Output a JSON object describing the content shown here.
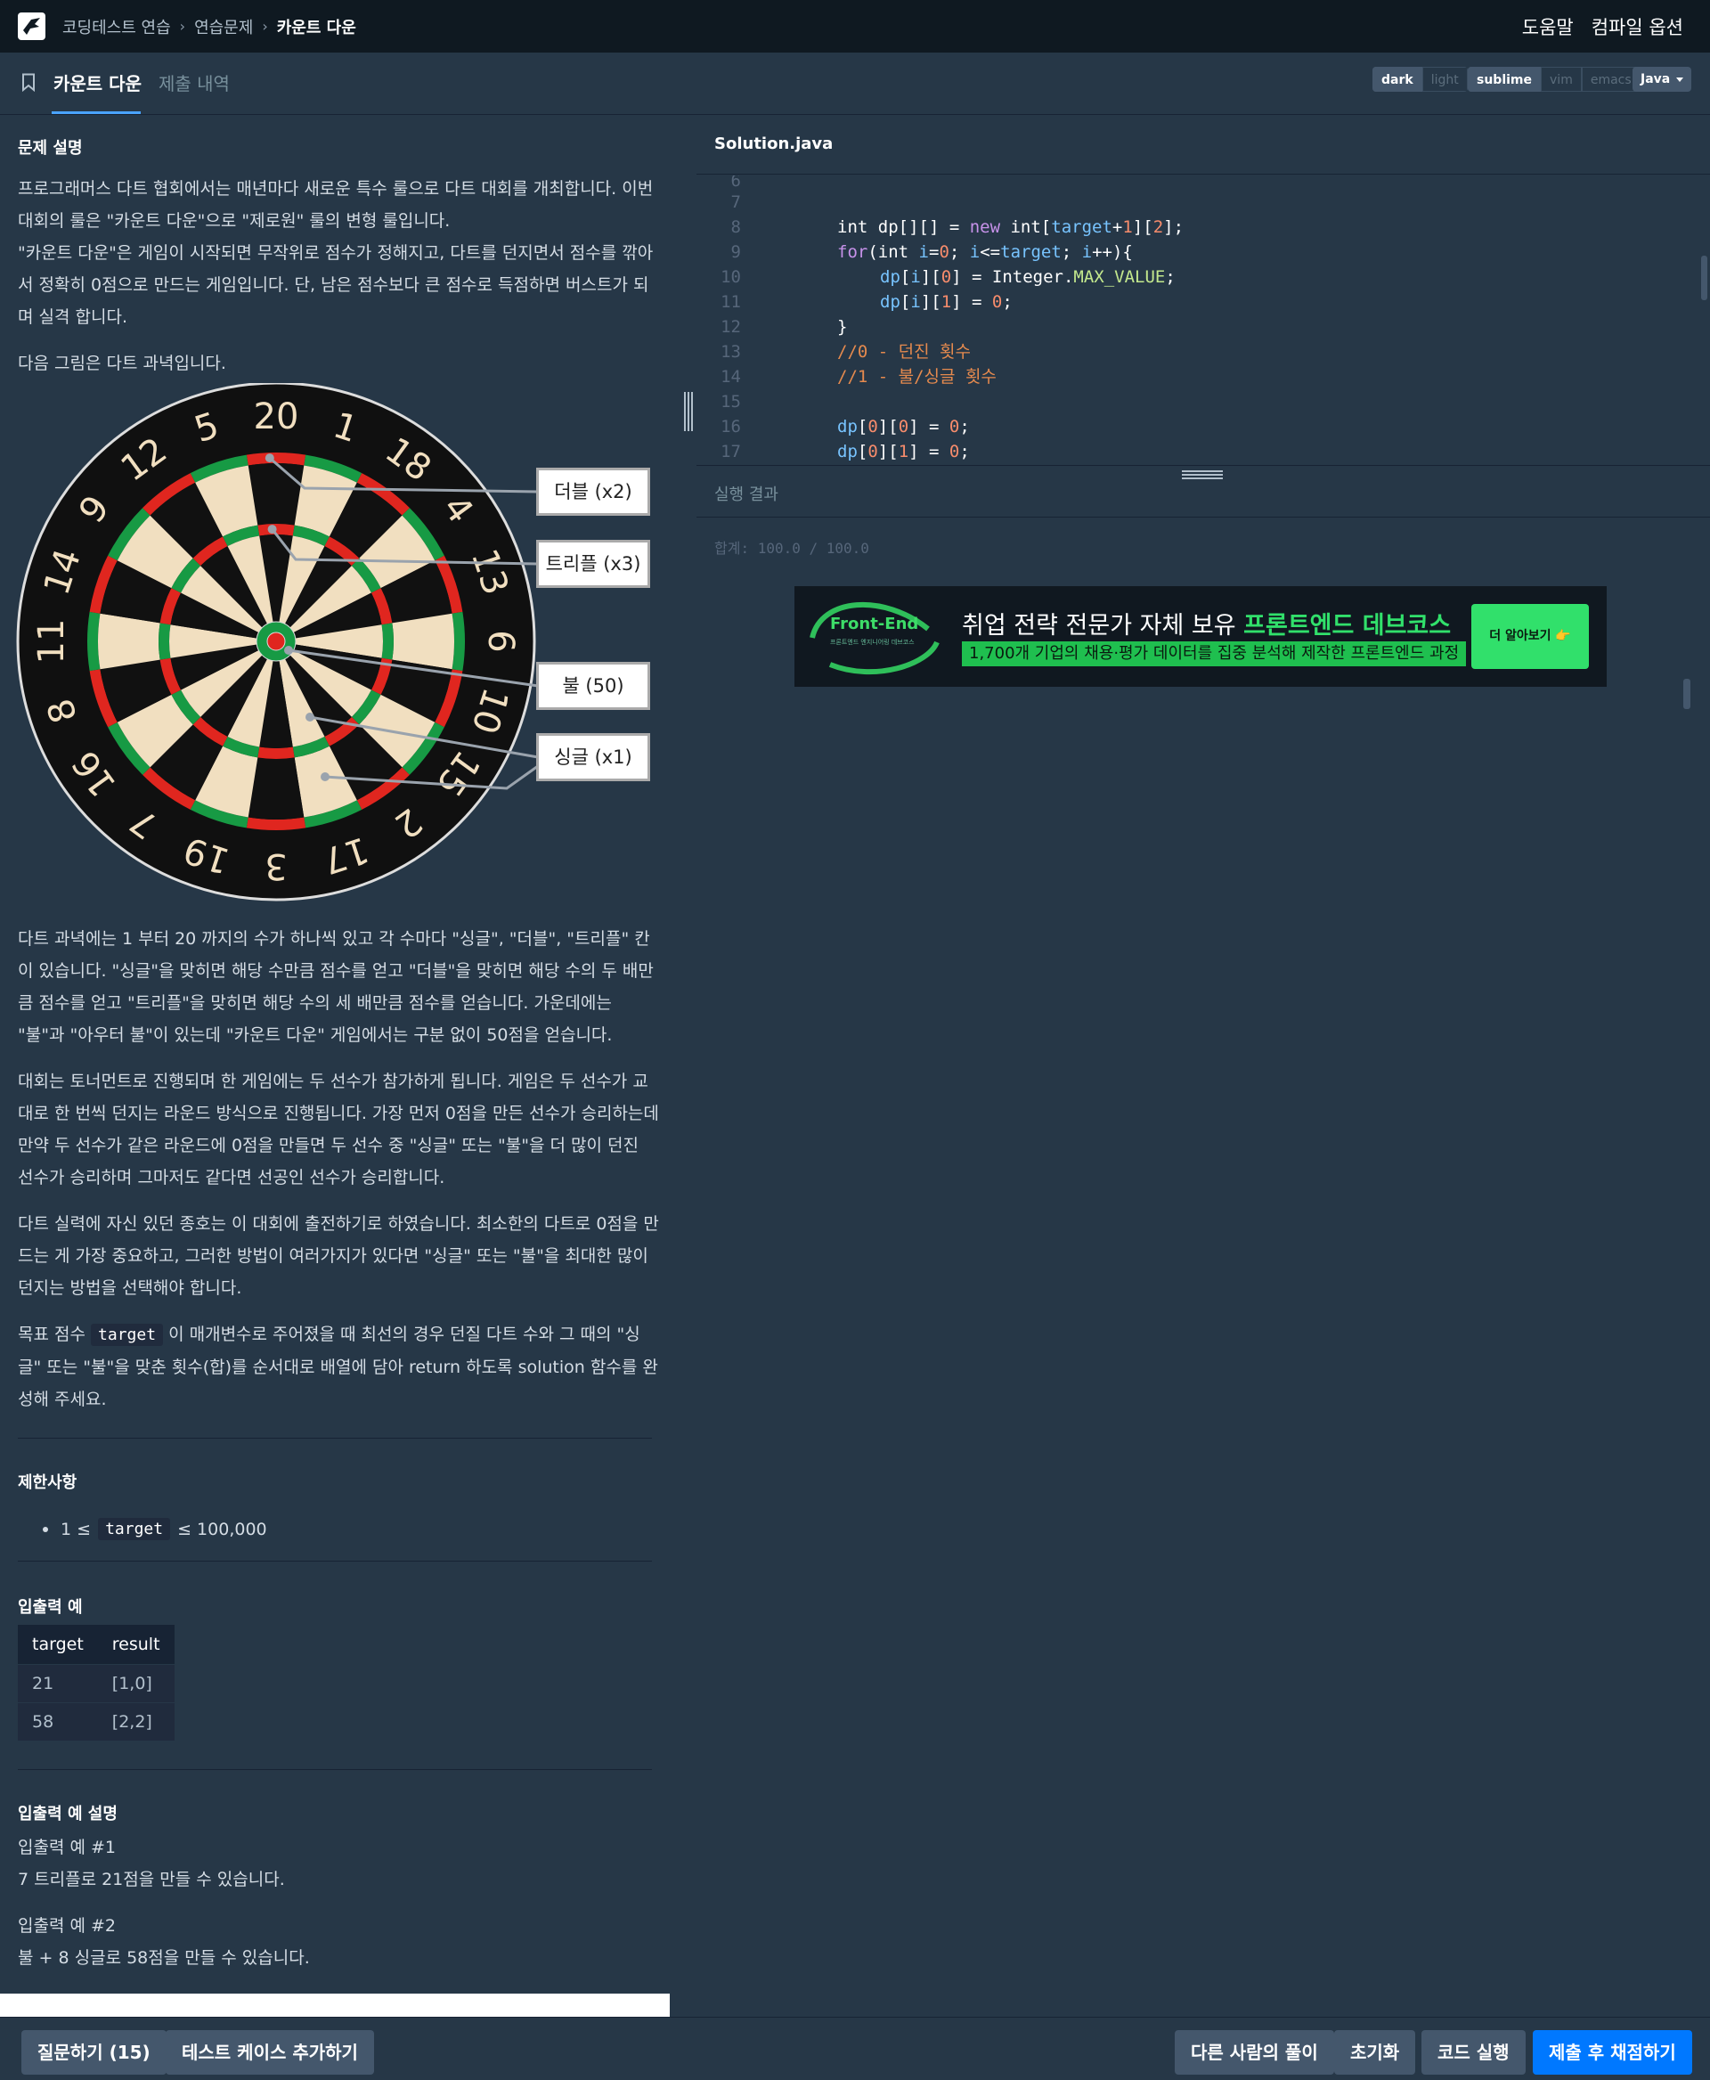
{
  "nav": {
    "breadcrumbs": [
      "코딩테스트 연습",
      "연습문제",
      "카운트 다운"
    ],
    "help": "도움말",
    "compile_options": "컴파일 옵션"
  },
  "tabs": {
    "active": "카운트 다운",
    "inactive": "제출 내역"
  },
  "theme_toggle": {
    "dark": "dark",
    "light": "light"
  },
  "keymap_toggle": {
    "sublime": "sublime",
    "vim": "vim",
    "emacs": "emacs"
  },
  "language": "Java",
  "problem": {
    "title": "문제 설명",
    "intro": [
      "프로그래머스 다트 협회에서는 매년마다 새로운 특수 룰으로 다트 대회를 개최합니다. 이번 대회의 룰은 \"카운트 다운\"으로 \"제로원\" 룰의 변형 룰입니다.",
      "\"카운트 다운\"은 게임이 시작되면 무작위로 점수가 정해지고, 다트를 던지면서 점수를 깎아서 정확히 0점으로 만드는 게임입니다. 단, 남은 점수보다 큰 점수로 득점하면 버스트가 되며 실격 합니다.",
      "다음 그림은 다트 과녁입니다."
    ],
    "board_numbers": [
      "20",
      "1",
      "18",
      "4",
      "13",
      "6",
      "10",
      "15",
      "2",
      "17",
      "3",
      "19",
      "7",
      "16",
      "8",
      "11",
      "14",
      "9",
      "12",
      "5"
    ],
    "board_labels": [
      "더블 (x2)",
      "트리플 (x3)",
      "불 (50)",
      "싱글 (x1)"
    ],
    "body": [
      "다트 과녁에는 1 부터 20 까지의 수가 하나씩 있고 각 수마다 \"싱글\", \"더블\", \"트리플\" 칸이 있습니다. \"싱글\"을 맞히면 해당 수만큼 점수를 얻고 \"더블\"을 맞히면 해당 수의 두 배만큼 점수를 얻고 \"트리플\"을 맞히면 해당 수의 세 배만큼 점수를 얻습니다. 가운데에는 \"불\"과 \"아우터 불\"이 있는데 \"카운트 다운\" 게임에서는 구분 없이 50점을 얻습니다.",
      "대회는 토너먼트로 진행되며 한 게임에는 두 선수가 참가하게 됩니다. 게임은 두 선수가 교대로 한 번씩 던지는 라운드 방식으로 진행됩니다. 가장 먼저 0점을 만든 선수가 승리하는데 만약 두 선수가 같은 라운드에 0점을 만들면 두 선수 중 \"싱글\" 또는 \"불\"을 더 많이 던진 선수가 승리하며 그마저도 같다면 선공인 선수가 승리합니다.",
      "다트 실력에 자신 있던 종호는 이 대회에 출전하기로 하였습니다. 최소한의 다트로 0점을 만드는 게 가장 중요하고, 그러한 방법이 여러가지가 있다면 \"싱글\" 또는 \"불\"을 최대한 많이 던지는 방법을 선택해야 합니다."
    ],
    "last_pre": "목표 점수",
    "last_code": "target",
    "last_post": "이 매개변수로 주어졌을 때 최선의 경우 던질 다트 수와 그 때의 \"싱글\" 또는 \"불\"을 맞춘 횟수(합)를 순서대로 배열에 담아 return 하도록 solution 함수를 완성해 주세요."
  },
  "constraints": {
    "title": "제한사항",
    "pre": "1 ≤",
    "code": "target",
    "post": "≤ 100,000"
  },
  "examples": {
    "title": "입출력 예",
    "headers": [
      "target",
      "result"
    ],
    "rows": [
      [
        "21",
        "[1,0]"
      ],
      [
        "58",
        "[2,2]"
      ]
    ]
  },
  "explanation": {
    "title": "입출력 예 설명",
    "items": [
      {
        "label": "입출력 예 #1",
        "text": "7 트리플로 21점을 만들 수 있습니다."
      },
      {
        "label": "입출력 예 #2",
        "text": "불 + 8 싱글로 58점을 만들 수 있습니다."
      }
    ]
  },
  "editor": {
    "filename": "Solution.java",
    "line_numbers": [
      "6",
      "7",
      "8",
      "9",
      "10",
      "11",
      "12",
      "13",
      "14",
      "15",
      "16",
      "17"
    ],
    "code": {
      "l8": [
        "int dp[][] = ",
        "new",
        " int[",
        "target",
        "+",
        "1",
        "][",
        "2",
        "];"
      ],
      "l9a": "for",
      "l9b": "(int ",
      "l9c": "i",
      "l9d": "=",
      "l9e": "0",
      "l9f": "; ",
      "l9g": "i",
      "l9h": "<=",
      "l9i": "target",
      "l9j": "; ",
      "l9k": "i",
      "l9l": "++){",
      "l10": [
        "dp",
        "[",
        "i",
        "][",
        "0",
        "] = Integer.",
        "MAX_VALUE",
        ";"
      ],
      "l11": [
        "dp",
        "[",
        "i",
        "][",
        "1",
        "] = ",
        "0",
        ";"
      ],
      "l12": "}",
      "l13": "//0 - 던진 횟수",
      "l14": "//1 - 불/싱글 횟수",
      "l16": [
        "dp",
        "[",
        "0",
        "][",
        "0",
        "] = ",
        "0",
        ";"
      ],
      "l17": [
        "dp",
        "[",
        "0",
        "][",
        "1",
        "] = ",
        "0",
        ";"
      ]
    }
  },
  "result": {
    "title": "실행 결과",
    "text": "합계: 100.0 / 100.0"
  },
  "ad": {
    "logo_title": "Front-End",
    "logo_sub": "프론트엔드 엔지니어링 데브코스",
    "headline_pre": "취업 전략 전문가 자체 보유 ",
    "headline_highlight": "프론트엔드 데브코스",
    "sub": "1,700개 기업의 채용·평가 데이터를 집중 분석해 제작한 프론트엔드 과정",
    "cta": "더 알아보기 👉"
  },
  "buttons": {
    "ask": "질문하기 (15)",
    "add_test": "테스트 케이스 추가하기",
    "others": "다른 사람의 풀이",
    "reset": "초기화",
    "run": "코드 실행",
    "submit": "제출 후 채점하기"
  },
  "colors": {
    "nav_bg": "#0f1921",
    "panel_bg": "#263747",
    "primary": "#0078ff",
    "accent_tab": "#4aa3ff"
  }
}
